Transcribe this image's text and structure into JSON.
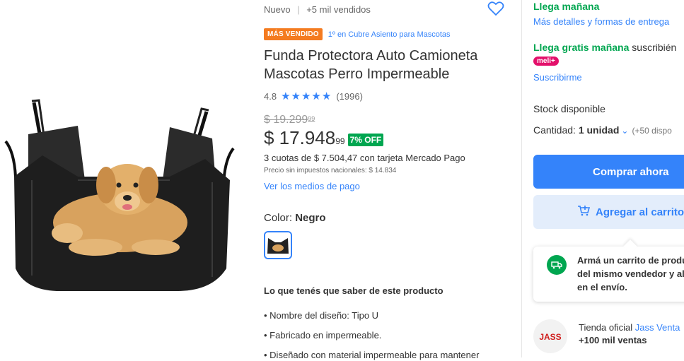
{
  "header": {
    "condition": "Nuevo",
    "separator": "|",
    "sold": "+5 mil vendidos"
  },
  "badge": {
    "label": "MÁS VENDIDO",
    "ranking": "1º en Cubre Asiento para Mascotas",
    "color": "#f47b20"
  },
  "product": {
    "title": "Funda Protectora Auto Camioneta Mascotas Perro Impermeable",
    "rating": "4.8",
    "stars": "★★★★★",
    "reviews": "(1996)"
  },
  "pricing": {
    "old_price": "$ 19.299",
    "old_cents": "99",
    "price": "$ 17.948",
    "price_cents": "99",
    "discount": "7% OFF",
    "installments": "3 cuotas de $ 7.504,47 con tarjeta Mercado Pago",
    "tax_note": "Precio sin impuestos nacionales: $ 14.834",
    "payment_link": "Ver los medios de pago"
  },
  "variant": {
    "label": "Color: ",
    "value": "Negro"
  },
  "features": {
    "title": "Lo que tenés que saber de este producto",
    "items": [
      "• Nombre del diseño: Tipo U",
      "• Fabricado en impermeable.",
      "• Diseñado con material impermeable para mantener"
    ]
  },
  "shipping": {
    "arrives": "Llega mañana",
    "details_link": "Más detalles y formas de entrega",
    "free_arrives": "Llega gratis mañana",
    "free_suffix": " suscribién",
    "meli_badge": "meli+",
    "subscribe_link": "Suscribirme"
  },
  "stock": {
    "label": "Stock disponible",
    "qty_label": "Cantidad: ",
    "qty_value": "1 unidad",
    "qty_extra": "(+50 dispo"
  },
  "actions": {
    "buy": "Comprar ahora",
    "add_cart": "Agregar al carrito"
  },
  "tooltip": {
    "line1": "Armá un carrito de produ",
    "line2": "del mismo vendedor y al",
    "line3": "en el envío."
  },
  "seller": {
    "prefix": "Tienda oficial ",
    "name": "Jass Venta",
    "sales": "+100 mil ventas",
    "logo_text": "JASS"
  },
  "colors": {
    "accent": "#3483fa",
    "green": "#00a650",
    "meli": "#e3106b"
  }
}
